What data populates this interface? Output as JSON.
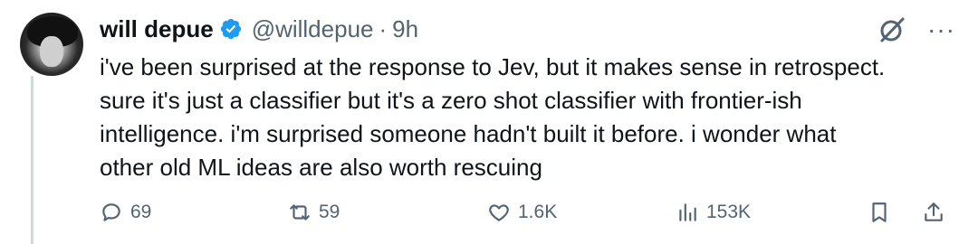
{
  "author": {
    "name": "will depue",
    "handle": "@willdepue",
    "separator": "·",
    "time": "9h"
  },
  "icons": {
    "verified": "verified-badge-icon",
    "grok": "grok-icon",
    "more": "more-options-icon",
    "reply": "reply-icon",
    "retweet": "retweet-icon",
    "like": "like-icon",
    "views": "views-icon",
    "bookmark": "bookmark-icon",
    "share": "share-icon"
  },
  "colors": {
    "verified": "#1d9bf0",
    "text": "#0f1419",
    "secondary": "#536471"
  },
  "tweet": {
    "text": "i've been surprised at the response to Jev, but it makes sense in retrospect.\nsure it's just a classifier but it's a zero shot classifier with frontier-ish\nintelligence. i'm surprised someone hadn't built it before. i wonder what\nother old ML ideas are also worth rescuing"
  },
  "stats": {
    "replies": "69",
    "retweets": "59",
    "likes": "1.6K",
    "views": "153K"
  }
}
